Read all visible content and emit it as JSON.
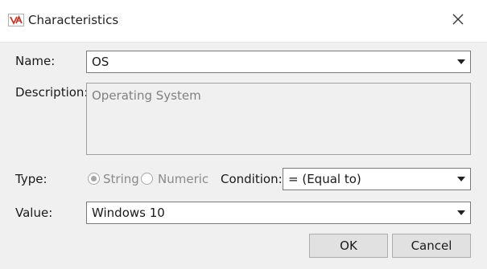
{
  "window": {
    "title": "Characteristics",
    "app_icon": "va-logo-icon",
    "close_icon": "close-icon"
  },
  "form": {
    "name_label": "Name:",
    "name_value": "OS",
    "description_label": "Description:",
    "description_value": "Operating System",
    "type_label": "Type:",
    "type_options": [
      {
        "label": "String",
        "selected": true
      },
      {
        "label": "Numeric",
        "selected": false
      }
    ],
    "condition_label": "Condition:",
    "condition_value": "= (Equal to)",
    "value_label": "Value:",
    "value_value": "Windows 10"
  },
  "buttons": {
    "ok_label": "OK",
    "cancel_label": "Cancel"
  },
  "colors": {
    "dialog_background": "#f0f0f0",
    "titlebar_background": "#ffffff",
    "disabled_text": "#8a8a8a",
    "logo_red": "#c0392b"
  }
}
